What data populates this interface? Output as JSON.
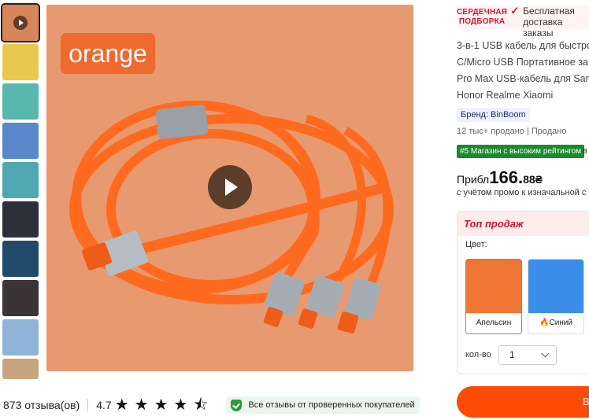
{
  "gallery": {
    "thumbs": [
      {
        "name": "thumb-video",
        "active": true,
        "color": "#d9855a"
      },
      {
        "name": "thumb-yellow-cable",
        "color": "#e8c94d"
      },
      {
        "name": "thumb-green-cable",
        "color": "#59b8ae"
      },
      {
        "name": "thumb-blue-cable",
        "color": "#5a87c9"
      },
      {
        "name": "thumb-teal-cable",
        "color": "#4fa7b1"
      },
      {
        "name": "thumb-charging-dark",
        "color": "#2d2f3a"
      },
      {
        "name": "thumb-lights-dark",
        "color": "#214a6b"
      },
      {
        "name": "thumb-orange-dark",
        "color": "#3a3436"
      },
      {
        "name": "thumb-blue-info",
        "color": "#8fb4d8"
      },
      {
        "name": "thumb-partial",
        "color": "#c9a57e"
      }
    ],
    "main_badge": "orange",
    "main_bg": "#e79a6f",
    "cable_color": "#ff6a1f"
  },
  "reviews": {
    "count_text": "873 отзыва(ов)",
    "rating": "4.7",
    "stars": 4.7,
    "verified_text": "Все отзывы от проверенных покупателей"
  },
  "selection": {
    "label": "СЕРДЕЧНАЯ ПОДБОРКА",
    "free_text": "Бесплатная доставка заказы"
  },
  "product": {
    "title_lines": [
      "3-в-1 USB кабель для быстрой",
      "C/Micro USB Портативное за",
      "Pro Max USB-кабель для Sam",
      "Honor Realme Xiaomi"
    ],
    "brand": "Бренд: BinBoom",
    "sold": "12 тыс+ продано | Продано",
    "shop_badge": "#5 Магазин с высоким рейтингом",
    "shop_after": "в",
    "price_prefix": "Прибл",
    "price_main": "166.",
    "price_cents": "88₴",
    "promo": "с учётом промо к изначальной с"
  },
  "options": {
    "top_sales": "Топ продаж",
    "color_label": "Цвет:",
    "colors": [
      {
        "label": "Апельсин",
        "color": "#f07634",
        "selected": true
      },
      {
        "label": "Синий",
        "color": "#3a8ee8",
        "selected": false
      }
    ],
    "qty_label": "кол-во",
    "qty_value": "1"
  },
  "buy": {
    "label": "В"
  }
}
